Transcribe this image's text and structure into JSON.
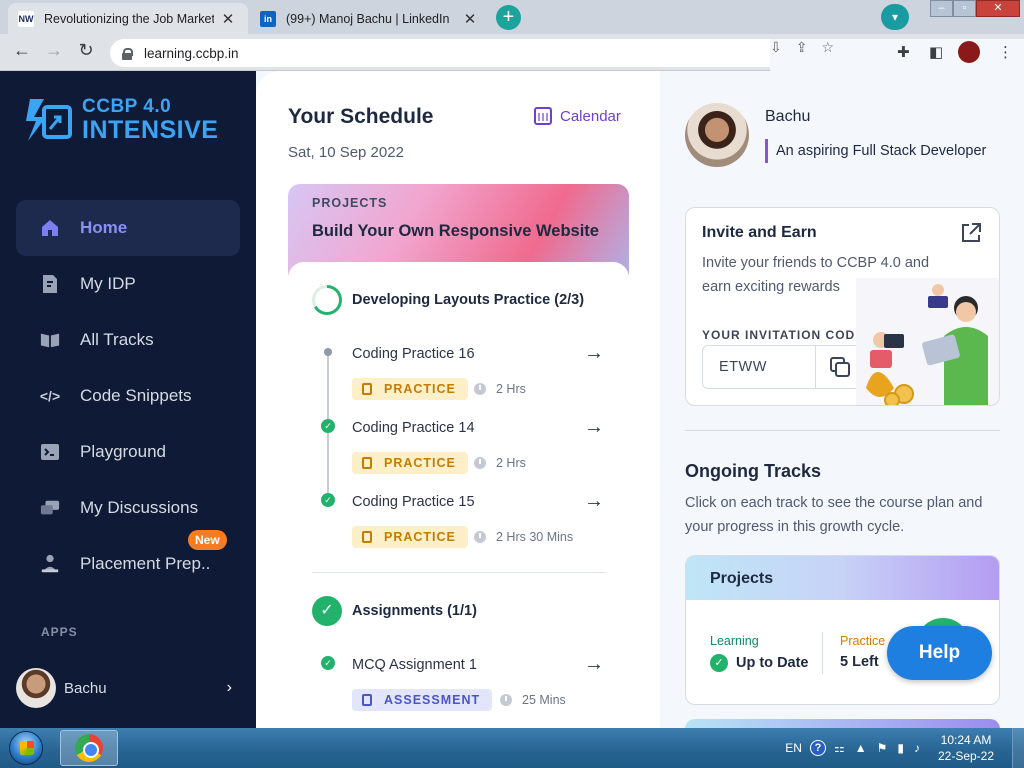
{
  "browser": {
    "tabs": [
      {
        "title": "Revolutionizing the Job Market | NxtWave",
        "favicon": "NW",
        "active": true
      },
      {
        "title": "(99+) Manoj Bachu | LinkedIn",
        "favicon": "in",
        "active": false
      }
    ],
    "url": "learning.ccbp.in"
  },
  "sidebar": {
    "logo_line1": "CCBP 4.0",
    "logo_line2": "INTENSIVE",
    "items": [
      {
        "label": "Home",
        "icon": "home-icon",
        "active": true
      },
      {
        "label": "My IDP",
        "icon": "idp-icon",
        "active": false
      },
      {
        "label": "All Tracks",
        "icon": "book-icon",
        "active": false
      },
      {
        "label": "Code Snippets",
        "icon": "code-icon",
        "active": false
      },
      {
        "label": "Playground",
        "icon": "terminal-icon",
        "active": false
      },
      {
        "label": "My Discussions",
        "icon": "discussions-icon",
        "active": false
      },
      {
        "label": "Placement Prep..",
        "icon": "placement-icon",
        "active": false
      }
    ],
    "new_badge": "New",
    "apps_label": "APPS",
    "user_name": "Bachu"
  },
  "schedule": {
    "title": "Your Schedule",
    "date": "Sat, 10 Sep 2022",
    "calendar_label": "Calendar",
    "project_tag": "PROJECTS",
    "project_name": "Build Your Own Responsive Website",
    "group1_title": "Developing Layouts Practice (2/3)",
    "group1_progress": 0.667,
    "items": [
      {
        "title": "Coding Practice 16",
        "type": "PRACTICE",
        "duration": "2 Hrs",
        "done": false
      },
      {
        "title": "Coding Practice 14",
        "type": "PRACTICE",
        "duration": "2 Hrs",
        "done": true
      },
      {
        "title": "Coding Practice 15",
        "type": "PRACTICE",
        "duration": "2 Hrs 30 Mins",
        "done": true
      }
    ],
    "group2_title": "Assignments (1/1)",
    "assignment": {
      "title": "MCQ Assignment 1",
      "type": "ASSESSMENT",
      "duration": "25 Mins",
      "done": true
    }
  },
  "profile": {
    "name": "Bachu",
    "bio": "An aspiring Full Stack Developer"
  },
  "invite": {
    "title": "Invite and Earn",
    "desc": "Invite your friends to CCBP 4.0 and earn exciting rewards",
    "code_label": "YOUR INVITATION CODE:",
    "code": "ETWW"
  },
  "ongoing": {
    "title": "Ongoing Tracks",
    "desc": "Click on each track to see the course plan and your progress in this growth cycle.",
    "track_name": "Projects",
    "learning_label": "Learning",
    "learning_value": "Up to Date",
    "practice_label": "Practice",
    "practice_value": "5 Left"
  },
  "help_label": "Help",
  "taskbar": {
    "lang": "EN",
    "time": "10:24 AM",
    "date": "22-Sep-22"
  },
  "colors": {
    "sidebar_bg": "#0f1b36",
    "accent_purple": "#6f3fd1",
    "brand_blue": "#3ba4f5",
    "success_green": "#23b26b",
    "help_blue": "#1f7fe0"
  }
}
